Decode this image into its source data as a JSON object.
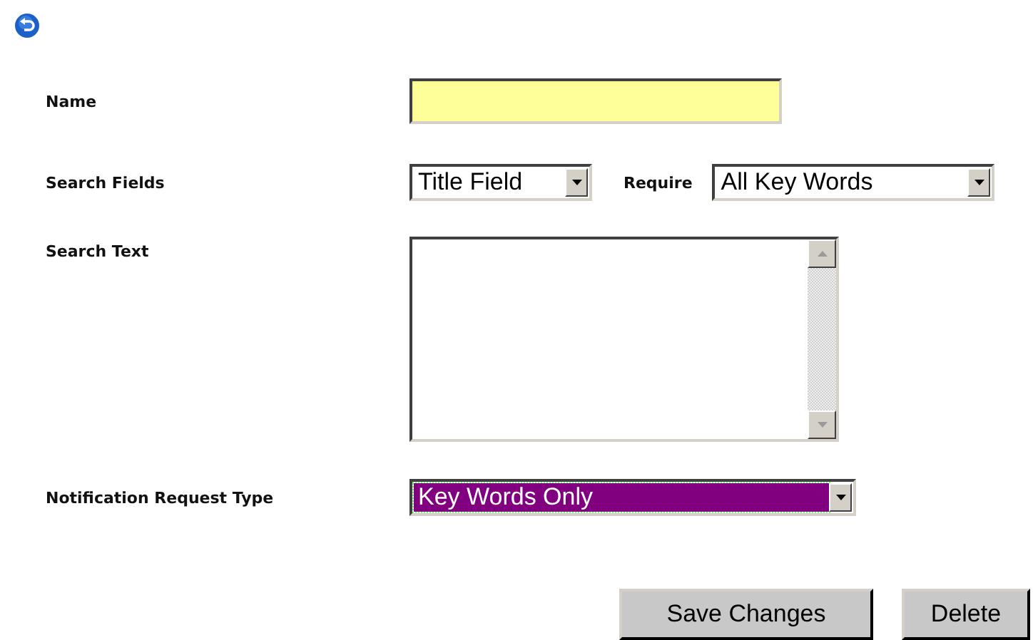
{
  "name": {
    "label": "Name"
  },
  "search_fields": {
    "label": "Search Fields",
    "value": "Title Field",
    "focused": false
  },
  "require": {
    "label": "Require",
    "value": "All Key Words",
    "focused": false
  },
  "search_text": {
    "label": "Search Text"
  },
  "notification_request_type": {
    "label": "Notification Request Type",
    "value": "Key Words Only",
    "focused": true
  },
  "buttons": [
    {
      "label": "Save Changes"
    },
    {
      "label": "Delete"
    }
  ]
}
